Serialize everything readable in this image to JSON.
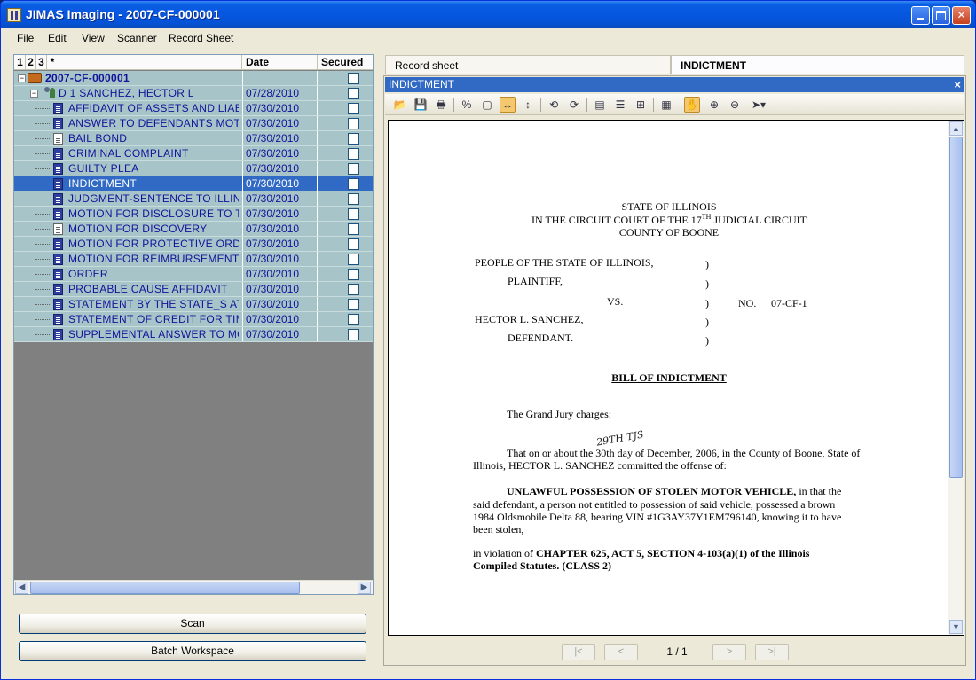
{
  "window": {
    "title": "JIMAS Imaging - 2007-CF-000001"
  },
  "menu": [
    "File",
    "Edit",
    "View",
    "Scanner",
    "Record Sheet"
  ],
  "tree": {
    "header_tabs": [
      "1",
      "2",
      "3",
      "*"
    ],
    "columns": {
      "date": "Date",
      "secured": "Secured"
    },
    "case": {
      "name": "2007-CF-000001"
    },
    "party": {
      "name": "D 1 SANCHEZ, HECTOR L",
      "date": "07/28/2010"
    },
    "documents": [
      {
        "name": "AFFIDAVIT OF ASSETS AND LIABILITI",
        "date": "07/30/2010",
        "icon": "doc-dark-icon"
      },
      {
        "name": "ANSWER TO DEFENDANTS MOTION",
        "date": "07/30/2010",
        "icon": "doc-dark-icon"
      },
      {
        "name": "BAIL BOND",
        "date": "07/30/2010",
        "icon": "doc-light-icon"
      },
      {
        "name": "CRIMINAL COMPLAINT",
        "date": "07/30/2010",
        "icon": "doc-dark-icon"
      },
      {
        "name": "GUILTY PLEA",
        "date": "07/30/2010",
        "icon": "doc-dark-icon"
      },
      {
        "name": "INDICTMENT",
        "date": "07/30/2010",
        "icon": "doc-dark-icon",
        "selected": true
      },
      {
        "name": "JUDGMENT-SENTENCE TO ILLINOIS",
        "date": "07/30/2010",
        "icon": "doc-dark-icon"
      },
      {
        "name": "MOTION FOR DISCLOSURE TO THE F",
        "date": "07/30/2010",
        "icon": "doc-dark-icon"
      },
      {
        "name": "MOTION FOR DISCOVERY",
        "date": "07/30/2010",
        "icon": "doc-light-icon"
      },
      {
        "name": "MOTION FOR PROTECTIVE ORDER",
        "date": "07/30/2010",
        "icon": "doc-dark-icon"
      },
      {
        "name": "MOTION FOR REIMBURSEMENT",
        "date": "07/30/2010",
        "icon": "doc-dark-icon"
      },
      {
        "name": "ORDER",
        "date": "07/30/2010",
        "icon": "doc-dark-icon"
      },
      {
        "name": "PROBABLE CAUSE AFFIDAVIT",
        "date": "07/30/2010",
        "icon": "doc-dark-icon"
      },
      {
        "name": "STATEMENT BY THE STATE_S ATTOI",
        "date": "07/30/2010",
        "icon": "doc-dark-icon"
      },
      {
        "name": "STATEMENT OF CREDIT FOR TIME SI",
        "date": "07/30/2010",
        "icon": "doc-dark-icon"
      },
      {
        "name": "SUPPLEMENTAL ANSWER TO MOTIC",
        "date": "07/30/2010",
        "icon": "doc-dark-icon"
      }
    ]
  },
  "buttons": {
    "scan": "Scan",
    "batch": "Batch Workspace"
  },
  "tabs": {
    "record_sheet": "Record sheet",
    "indictment": "INDICTMENT"
  },
  "viewer": {
    "title": "INDICTMENT",
    "close": "×",
    "page_indicator": "1 / 1",
    "pager": {
      "first": "|<",
      "prev": "<",
      "next": ">",
      "last": ">|"
    }
  },
  "document": {
    "header1": "STATE OF ILLINOIS",
    "header2_pre": "IN THE CIRCUIT COURT OF THE 17",
    "header2_sup": "TH",
    "header2_post": " JUDICIAL CIRCUIT",
    "header3": "COUNTY OF BOONE",
    "people": "PEOPLE OF THE STATE OF ILLINOIS,",
    "plaintiff": "PLAINTIFF,",
    "vs": "VS.",
    "no_label": "NO.",
    "no_value": "07-CF-1",
    "defendant_name": "HECTOR L. SANCHEZ,",
    "defendant": "DEFENDANT.",
    "paren": ")",
    "bill_title": "BILL OF INDICTMENT",
    "grand_jury": "The Grand Jury charges:",
    "charge_line1": "That on or about the 30th day of December, 2006, in the County of Boone, State of",
    "charge_line2": "Illinois, HECTOR L. SANCHEZ committed the offense of:",
    "handwritten": "29TH TJS",
    "offense_bold": "UNLAWFUL POSSESSION OF STOLEN MOTOR VEHICLE,",
    "offense_rest1": " in that the",
    "offense_line2": "said defendant, a person not entitled to possession of said vehicle, possessed a brown",
    "offense_line3": "1984 Oldsmobile Delta 88, bearing VIN #1G3AY37Y1EM796140, knowing it to have",
    "offense_line4": "been stolen,",
    "violation_pre": "in violation of ",
    "violation_bold": "CHAPTER 625, ACT 5, SECTION 4-103(a)(1) of the Illinois",
    "violation_line2": "Compiled Statutes.  (CLASS 2)"
  }
}
